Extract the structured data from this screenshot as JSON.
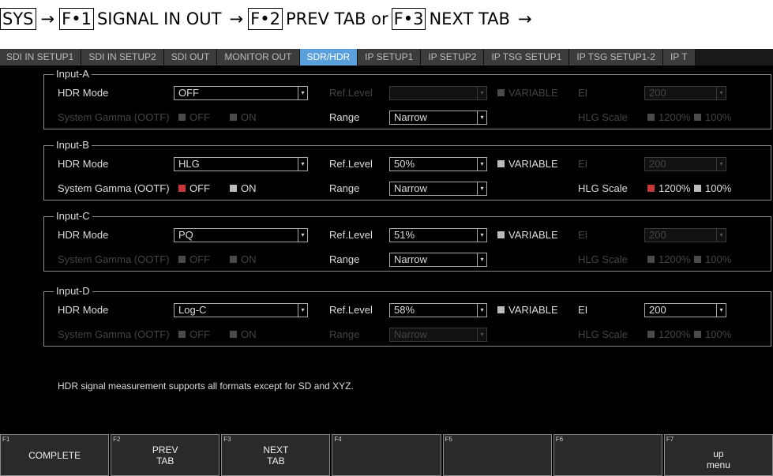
{
  "breadcrumb": {
    "sys": "SYS",
    "arrow": "→",
    "f1_key": "F•1",
    "f1_text": "SIGNAL IN OUT",
    "f2_key": "F•2",
    "f2_text": "PREV TAB or",
    "f3_key": "F•3",
    "f3_text": "NEXT TAB"
  },
  "tabs": [
    "SDI IN SETUP1",
    "SDI IN SETUP2",
    "SDI OUT",
    "MONITOR OUT",
    "SDR/HDR",
    "IP SETUP1",
    "IP SETUP2",
    "IP TSG SETUP1",
    "IP TSG SETUP1-2",
    "IP T"
  ],
  "active_tab": "SDR/HDR",
  "labels": {
    "hdr_mode": "HDR Mode",
    "system_gamma": "System Gamma (OOTF)",
    "ref_level": "Ref.Level",
    "range": "Range",
    "variable": "VARIABLE",
    "ei": "EI",
    "hlg_scale": "HLG Scale",
    "off": "OFF",
    "on": "ON",
    "scale_1200": "1200%",
    "scale_100": "100%"
  },
  "inputs": [
    {
      "title": "Input-A",
      "hdr_mode": "OFF",
      "ref_level": "",
      "range": "Narrow",
      "ei": "200"
    },
    {
      "title": "Input-B",
      "hdr_mode": "HLG",
      "ref_level": "50%",
      "range": "Narrow",
      "ei": "200"
    },
    {
      "title": "Input-C",
      "hdr_mode": "PQ",
      "ref_level": "51%",
      "range": "Narrow",
      "ei": "200"
    },
    {
      "title": "Input-D",
      "hdr_mode": "Log-C",
      "ref_level": "58%",
      "range": "Narrow",
      "ei": "200"
    }
  ],
  "note": "HDR signal measurement supports all formats except for SD and XYZ.",
  "fkeys": [
    {
      "num": "F1",
      "label": "COMPLETE",
      "label2": ""
    },
    {
      "num": "F2",
      "label": "PREV",
      "label2": "TAB"
    },
    {
      "num": "F3",
      "label": "NEXT",
      "label2": "TAB"
    },
    {
      "num": "F4",
      "label": "",
      "label2": ""
    },
    {
      "num": "F5",
      "label": "",
      "label2": ""
    },
    {
      "num": "F6",
      "label": "",
      "label2": ""
    },
    {
      "num": "F7",
      "label": "up",
      "label2": "menu"
    }
  ],
  "colors": {
    "active_tab": "#5aa0dc",
    "checked": "#c8383a"
  }
}
